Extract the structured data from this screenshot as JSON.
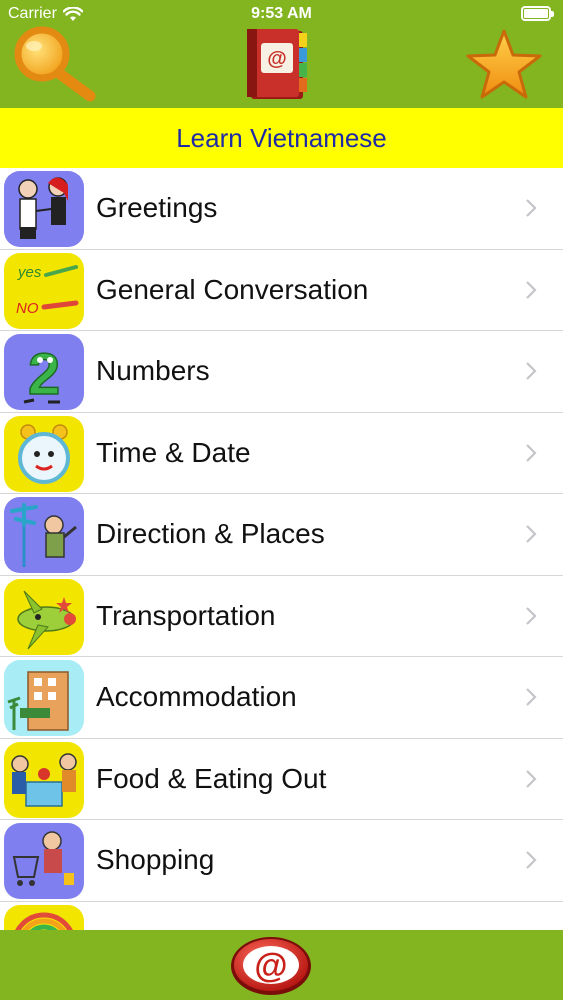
{
  "status": {
    "carrier": "Carrier",
    "time": "9:53 AM"
  },
  "header": {
    "title": "Learn Vietnamese"
  },
  "toolbar": {
    "left_icon": "search-icon",
    "center_icon": "address-book-icon",
    "right_icon": "star-icon",
    "bottom_icon": "at-sign-icon"
  },
  "colors": {
    "bar_green": "#82b51f",
    "title_yellow": "#ffff00",
    "title_text": "#1e2aa8",
    "icon_purple": "#7f7ff0",
    "icon_yellow": "#f2e600",
    "icon_cyan": "#a8ecf5"
  },
  "items": [
    {
      "label": "Greetings",
      "icon": "greetings-icon"
    },
    {
      "label": "General Conversation",
      "icon": "yes-no-icon"
    },
    {
      "label": "Numbers",
      "icon": "number-two-icon"
    },
    {
      "label": "Time & Date",
      "icon": "alarm-clock-icon"
    },
    {
      "label": "Direction & Places",
      "icon": "signpost-icon"
    },
    {
      "label": "Transportation",
      "icon": "airplane-icon"
    },
    {
      "label": "Accommodation",
      "icon": "hotel-icon"
    },
    {
      "label": "Food & Eating Out",
      "icon": "dining-icon"
    },
    {
      "label": "Shopping",
      "icon": "shopping-cart-icon"
    },
    {
      "label": "",
      "icon": "rainbow-icon"
    }
  ]
}
